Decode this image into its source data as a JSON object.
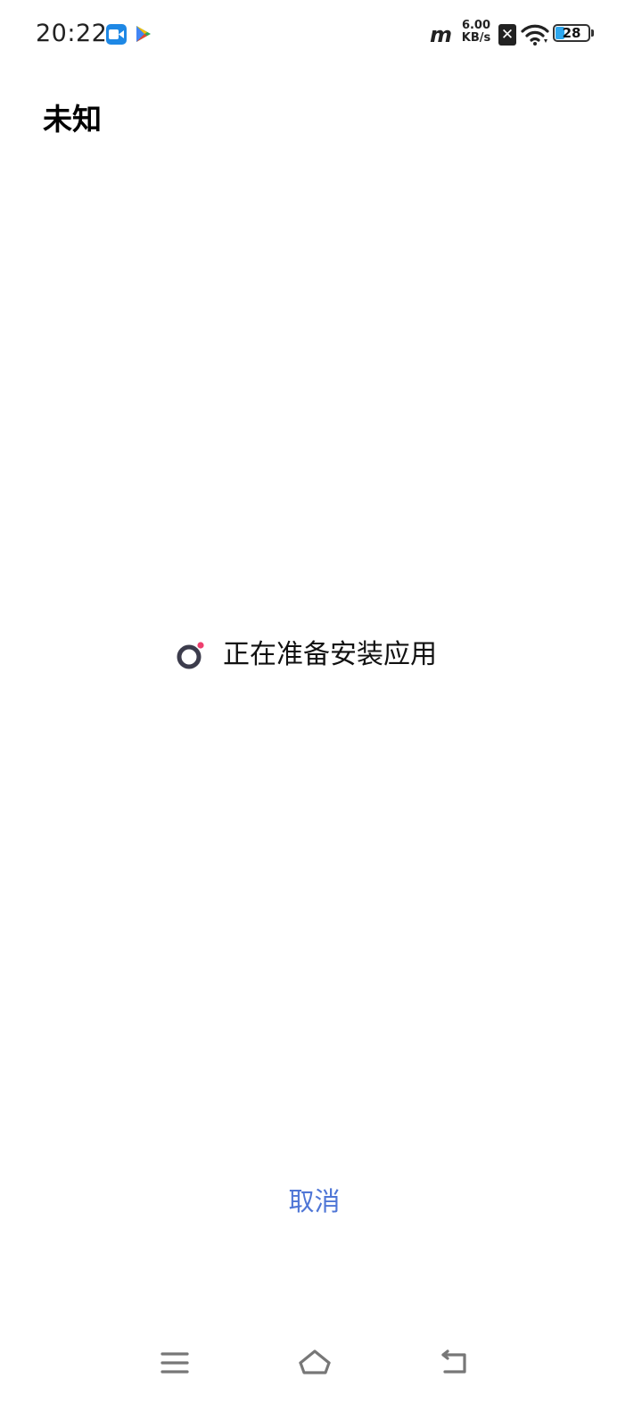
{
  "status_bar": {
    "time": "20:22",
    "net_speed_value": "6.00",
    "net_speed_unit": "KB/s",
    "carrier_label": "m",
    "sim_label": "✕",
    "battery_level": "28",
    "battery_fraction": 0.28,
    "icons": [
      "video-call-icon",
      "play-store-icon",
      "signal-icon",
      "sim-error-icon",
      "wifi-icon",
      "battery-icon"
    ]
  },
  "header": {
    "title": "未知"
  },
  "main": {
    "status_text": "正在准备安装应用"
  },
  "actions": {
    "cancel_label": "取消"
  },
  "nav_bar": {
    "icons": [
      "menu-icon",
      "home-icon",
      "back-icon"
    ]
  },
  "colors": {
    "accent": "#4f76d6",
    "spinner_ring": "#3c3c4c",
    "spinner_dot": "#ee3f6e",
    "battery_fill": "#2ea7ee"
  }
}
